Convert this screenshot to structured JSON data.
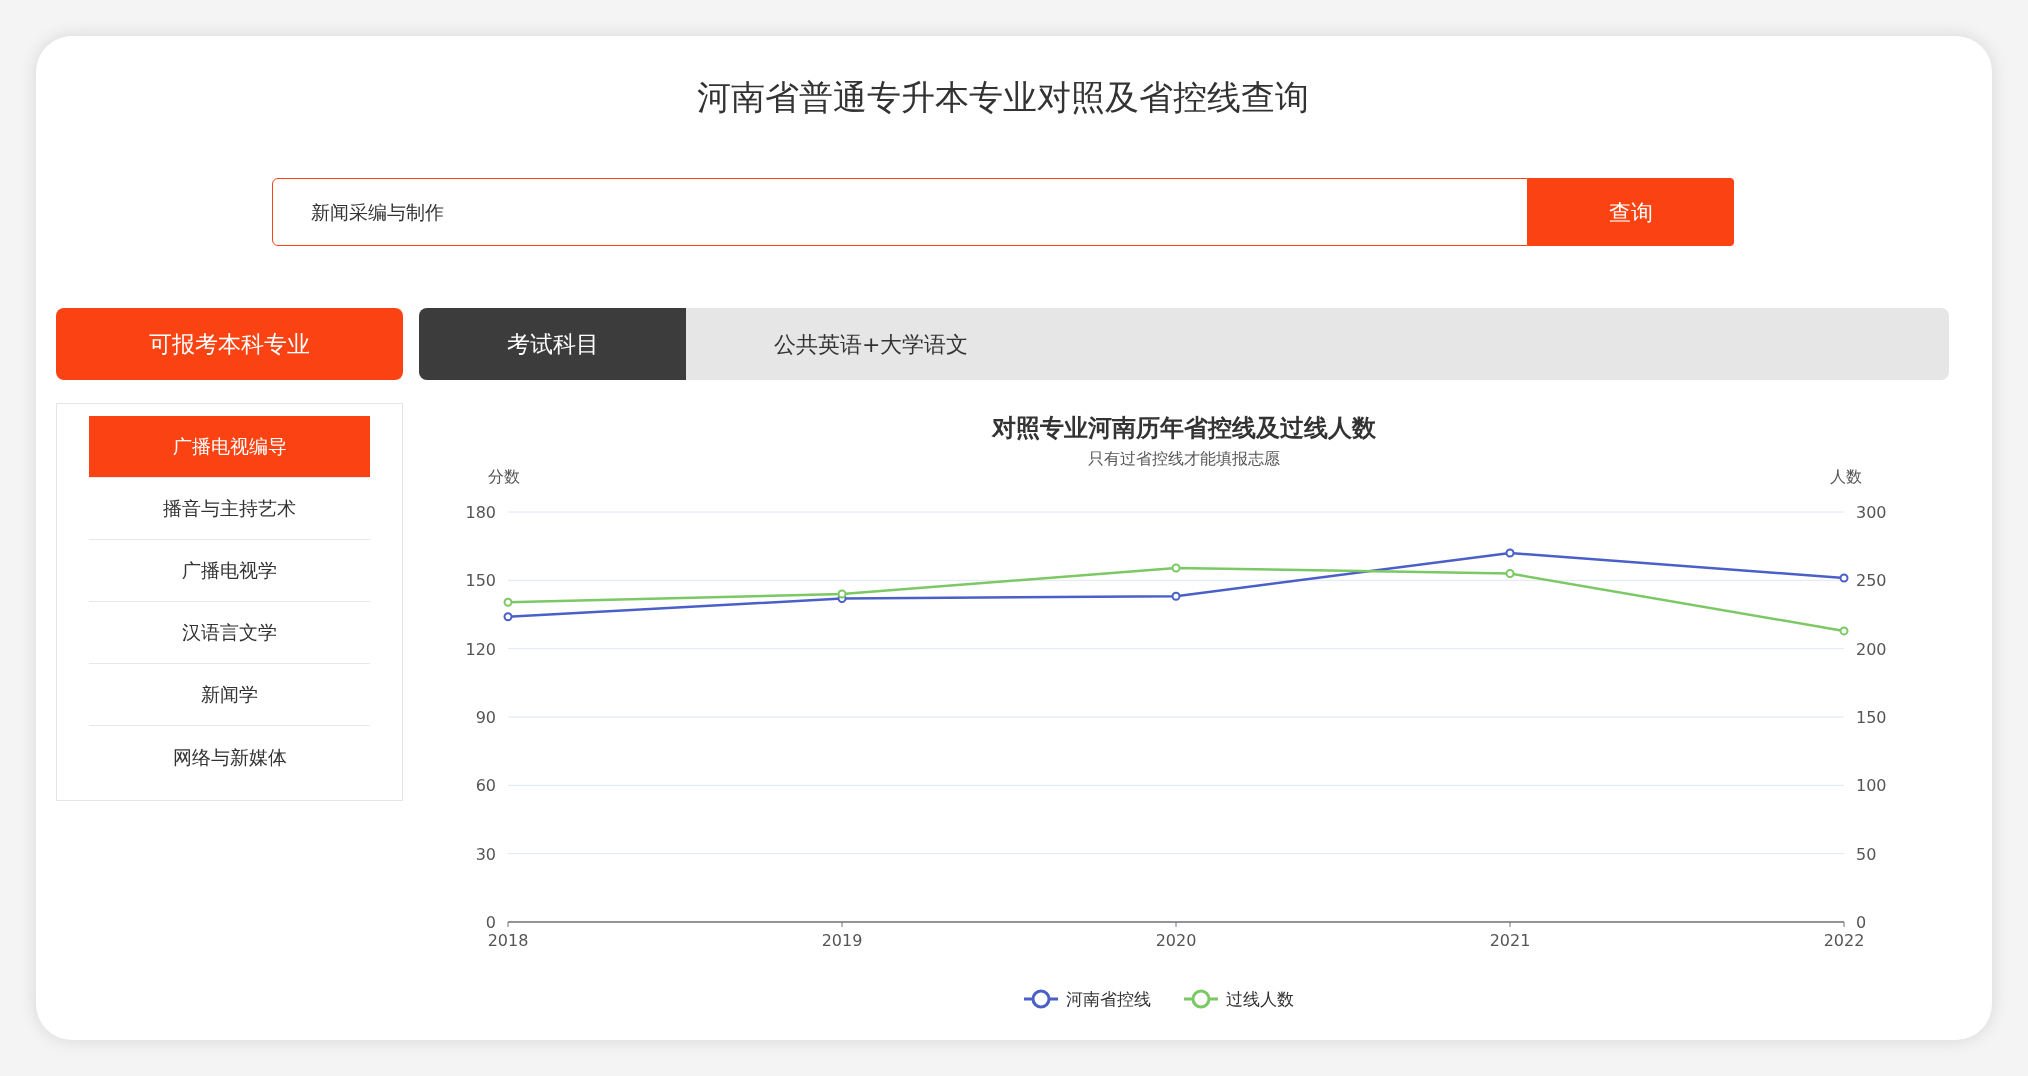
{
  "page_title": "河南省普通专升本专业对照及省控线查询",
  "search": {
    "value": "新闻采编与制作",
    "button": "查询"
  },
  "left_header": "可报考本科专业",
  "majors": [
    {
      "label": "广播电视编导",
      "selected": true
    },
    {
      "label": "播音与主持艺术",
      "selected": false
    },
    {
      "label": "广播电视学",
      "selected": false
    },
    {
      "label": "汉语言文学",
      "selected": false
    },
    {
      "label": "新闻学",
      "selected": false
    },
    {
      "label": "网络与新媒体",
      "selected": false
    }
  ],
  "exam": {
    "label": "考试科目",
    "subjects": "公共英语+大学语文"
  },
  "chart_data": {
    "type": "line",
    "title": "对照专业河南历年省控线及过线人数",
    "subtitle": "只有过省控线才能填报志愿",
    "ylabel": "分数",
    "y2label": "人数",
    "categories": [
      "2018",
      "2019",
      "2020",
      "2021",
      "2022"
    ],
    "grid": true,
    "legend": "bottom",
    "ylim": [
      0,
      180
    ],
    "y2lim": [
      0,
      300
    ],
    "yticks": [
      0,
      30,
      60,
      90,
      120,
      150,
      180
    ],
    "y2ticks": [
      0,
      50,
      100,
      150,
      200,
      250,
      300
    ],
    "series": [
      {
        "name": "河南省控线",
        "color": "#4a5fc8",
        "marker": "circle",
        "values": [
          134,
          142,
          143,
          162,
          151
        ]
      },
      {
        "name": "过线人数",
        "color": "#7cc864",
        "axis": "y2",
        "marker": "circle",
        "values": [
          234,
          240,
          259,
          255,
          213
        ]
      }
    ]
  }
}
